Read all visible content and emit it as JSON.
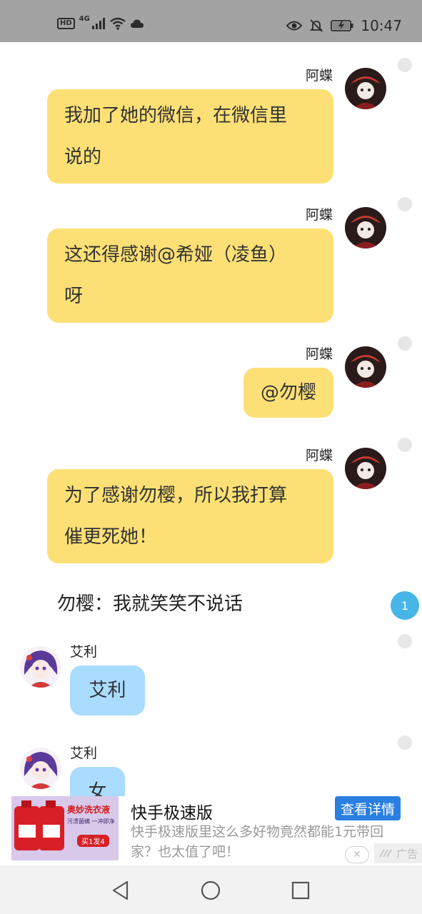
{
  "status_bar": {
    "hd": "HD",
    "network": "4G",
    "time": "10:47",
    "icons": [
      "signal-icon",
      "wifi-icon",
      "cloud-icon",
      "eye-icon",
      "bell-off-icon",
      "battery-icon"
    ]
  },
  "messages": [
    {
      "side": "right",
      "sender": "阿蝶",
      "lines": [
        "我加了她的微信，在微信里",
        "说的"
      ]
    },
    {
      "side": "right",
      "sender": "阿蝶",
      "lines": [
        "这还得感谢@希娅（凌鱼）",
        "呀"
      ]
    },
    {
      "side": "right",
      "sender": "阿蝶",
      "lines": [
        "@勿樱"
      ]
    },
    {
      "side": "right",
      "sender": "阿蝶",
      "lines": [
        "为了感谢勿樱，所以我打算",
        "催更死她！"
      ]
    },
    {
      "side": "left",
      "sender": "艾利",
      "lines": [
        "艾利"
      ]
    },
    {
      "side": "left",
      "sender": "艾利",
      "lines": [
        "女"
      ]
    }
  ],
  "narration": "勿樱：我就笑笑不说话",
  "unread_count": "1",
  "ad": {
    "title": "快手极速版",
    "description": "快手极速版里这么多好物竟然都能1元带回家？也太值了吧！",
    "button": "查看详情",
    "label": "广告",
    "image_text": {
      "brand": "奥妙洗衣液",
      "line1": "污渍菌螨 一冲即净",
      "promo": "买1发4"
    }
  },
  "colors": {
    "right_bubble": "#fde075",
    "left_bubble": "#a9dcff",
    "status_bar": "#a3a3a3",
    "badge": "#47b6e6",
    "ad_button": "#2a7fe0"
  }
}
